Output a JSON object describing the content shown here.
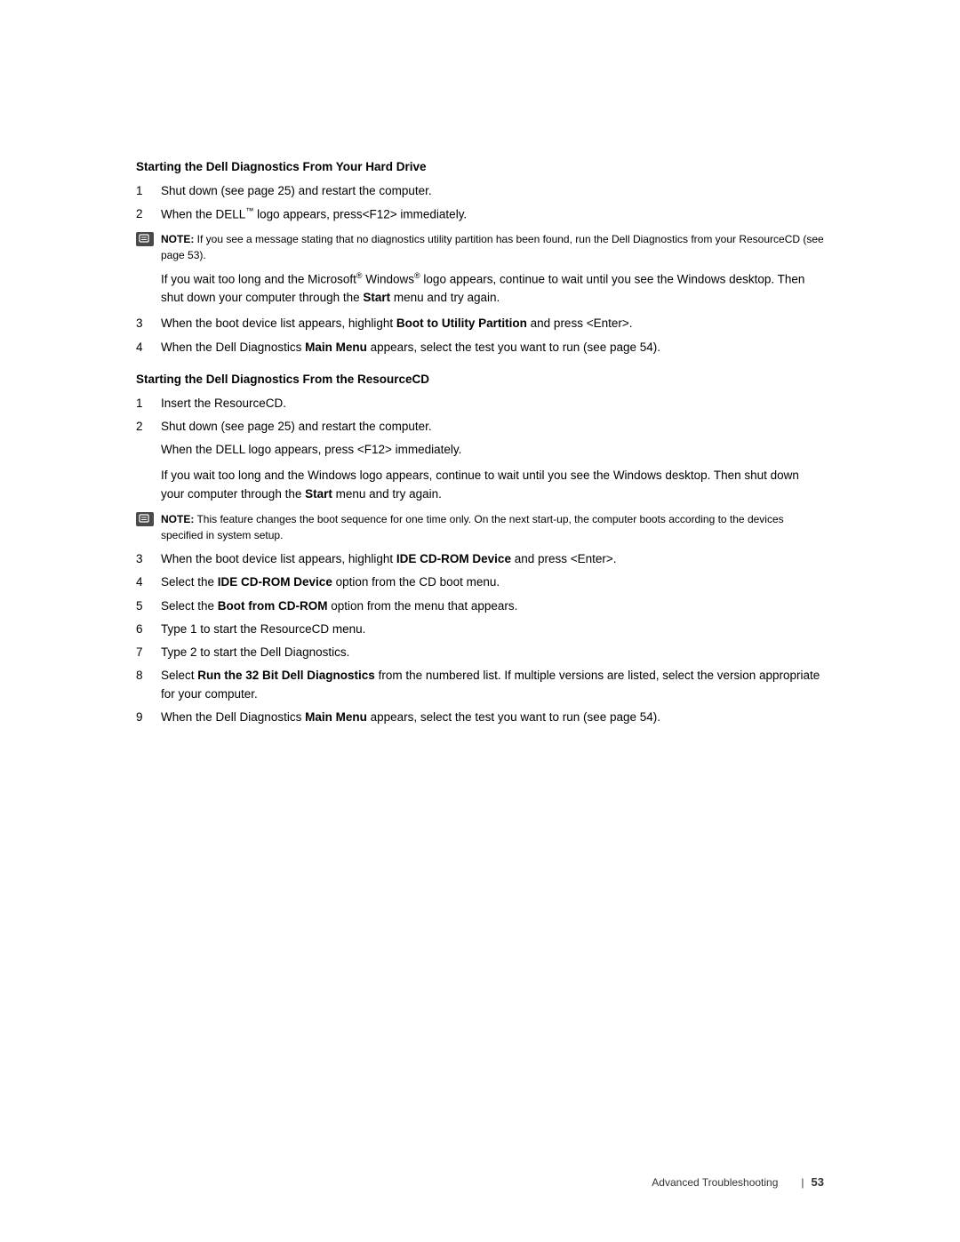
{
  "page": {
    "background": "#ffffff"
  },
  "section1": {
    "heading": "Starting the Dell Diagnostics From Your Hard Drive",
    "steps": [
      {
        "num": "1",
        "text": "Shut down (see page 25) and restart the computer."
      },
      {
        "num": "2",
        "text_before": "When the DELL",
        "tm": "™",
        "text_after": " logo appears, press<F12> immediately."
      }
    ],
    "note1": {
      "label": "NOTE:",
      "text": " If you see a message stating that no diagnostics utility partition has been found, run the Dell Diagnostics from your ResourceCD (see page 53)."
    },
    "para1_before": "If you wait too long and the Microsoft",
    "para1_sup1": "®",
    "para1_mid": " Windows",
    "para1_sup2": "®",
    "para1_after": " logo appears, continue to wait until you see the Windows desktop. Then shut down your computer through the ",
    "para1_bold": "Start",
    "para1_end": " menu and try again.",
    "steps2": [
      {
        "num": "3",
        "text_before": "When the boot device list appears, highlight ",
        "bold": "Boot to Utility Partition",
        "text_after": " and press <Enter>."
      },
      {
        "num": "4",
        "text_before": "When the Dell Diagnostics ",
        "bold": "Main Menu",
        "text_after": " appears, select the test you want to run (see page 54)."
      }
    ]
  },
  "section2": {
    "heading": "Starting the Dell Diagnostics From the ResourceCD",
    "steps": [
      {
        "num": "1",
        "text": "Insert the ResourceCD."
      },
      {
        "num": "2",
        "text": "Shut down (see page 25) and restart the computer."
      }
    ],
    "para2": "When the DELL logo appears, press <F12> immediately.",
    "para3_before": "If you wait too long and the Windows logo appears, continue to wait until you see the Windows desktop. Then shut down your computer through the ",
    "para3_bold": "Start",
    "para3_after": " menu and try again.",
    "note2": {
      "label": "NOTE:",
      "text": " This feature changes the boot sequence for one time only. On the next start-up, the computer boots according to the devices specified in system setup."
    },
    "steps2": [
      {
        "num": "3",
        "text_before": "When the boot device list appears, highlight ",
        "bold": "IDE CD-ROM Device",
        "text_after": " and press <Enter>."
      },
      {
        "num": "4",
        "text_before": "Select the ",
        "bold": "IDE CD-ROM Device",
        "text_after": " option from the CD boot menu."
      },
      {
        "num": "5",
        "text_before": "Select the ",
        "bold": "Boot from CD-ROM",
        "text_after": " option from the menu that appears."
      },
      {
        "num": "6",
        "text": "Type 1 to start the ResourceCD menu."
      },
      {
        "num": "7",
        "text": "Type 2 to start the Dell Diagnostics."
      },
      {
        "num": "8",
        "text_before": "Select ",
        "bold": "Run the 32 Bit Dell Diagnostics",
        "text_after": " from the numbered list. If multiple versions are listed, select the version appropriate for your computer."
      },
      {
        "num": "9",
        "text_before": "When the Dell Diagnostics ",
        "bold": "Main Menu",
        "text_after": " appears, select the test you want to run (see page 54)."
      }
    ]
  },
  "footer": {
    "section_label": "Advanced Troubleshooting",
    "divider": "|",
    "page_number": "53"
  }
}
